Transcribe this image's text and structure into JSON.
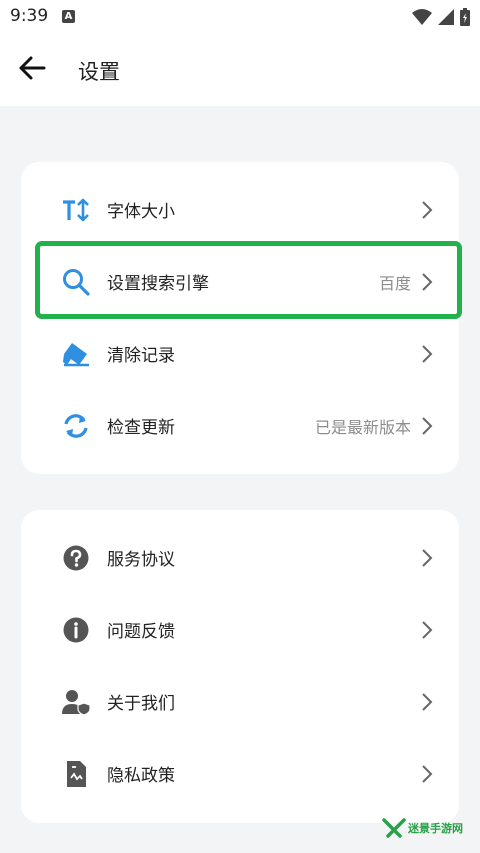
{
  "status_bar": {
    "time": "9:39",
    "notif_letter": "A",
    "icons": [
      "wifi-icon",
      "signal-icon",
      "battery-icon"
    ]
  },
  "header": {
    "title": "设置",
    "back_icon": "back-arrow-icon"
  },
  "settings_group_1": [
    {
      "icon": "font-size-icon",
      "label": "字体大小",
      "value": ""
    },
    {
      "icon": "search-icon",
      "label": "设置搜索引擎",
      "value": "百度"
    },
    {
      "icon": "eraser-icon",
      "label": "清除记录",
      "value": ""
    },
    {
      "icon": "refresh-icon",
      "label": "检查更新",
      "value": "已是最新版本"
    }
  ],
  "settings_group_2": [
    {
      "icon": "help-icon",
      "label": "服务协议"
    },
    {
      "icon": "info-icon",
      "label": "问题反馈"
    },
    {
      "icon": "user-shield-icon",
      "label": "关于我们"
    },
    {
      "icon": "document-icon",
      "label": "隐私政策"
    }
  ],
  "highlight_color": "#22b14c",
  "accent_color": "#2f8fe0",
  "watermark": {
    "text": "迷景手游网"
  }
}
